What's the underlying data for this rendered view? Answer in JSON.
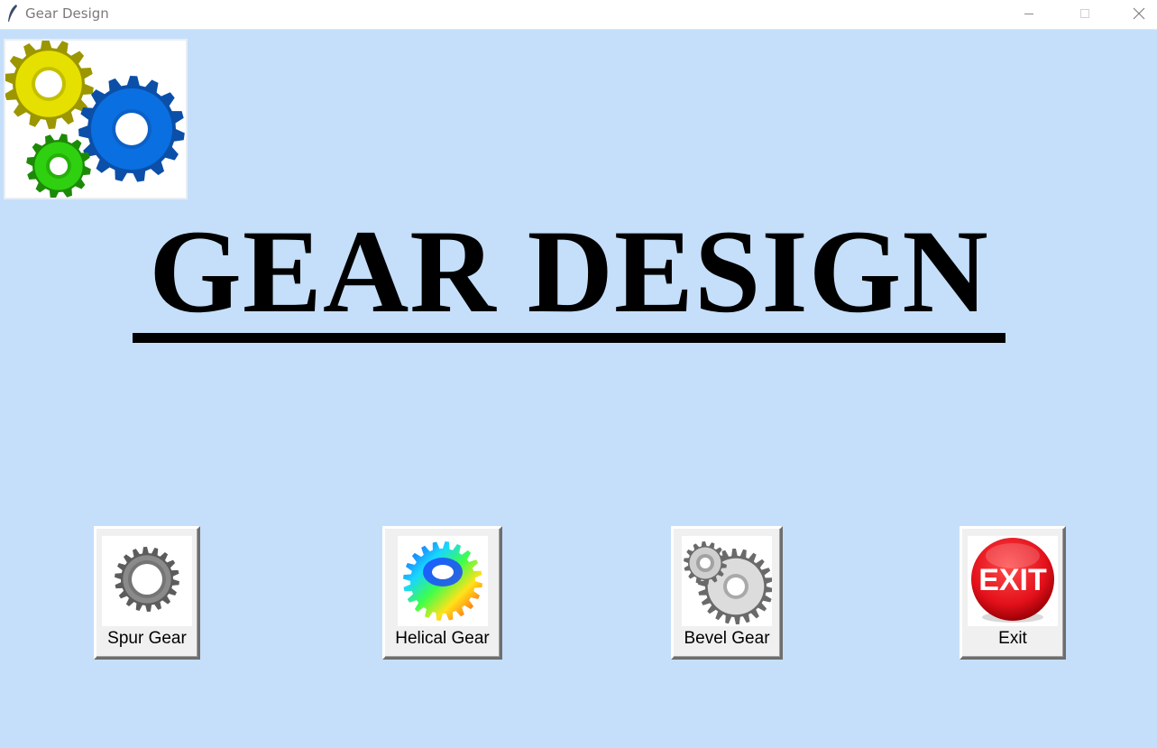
{
  "window": {
    "title": "Gear Design",
    "app_icon": "feather-icon",
    "controls": [
      "minimize-icon",
      "maximize-icon",
      "close-icon"
    ]
  },
  "logo": {
    "icon": "gears-logo"
  },
  "main": {
    "heading": "GEAR DESIGN"
  },
  "buttons": [
    {
      "label": "Spur Gear",
      "icon": "spur-gear-icon"
    },
    {
      "label": "Helical Gear",
      "icon": "helical-gear-icon"
    },
    {
      "label": "Bevel Gear",
      "icon": "bevel-gear-icon"
    },
    {
      "label": "Exit",
      "icon": "exit-sign-icon",
      "sign_text": "EXIT"
    }
  ],
  "colors": {
    "background": "#c5dffa",
    "exit_red": "#e3101a",
    "gear_yellow": "#e6e000",
    "gear_blue": "#0a6fe0",
    "gear_green": "#2ed010"
  }
}
